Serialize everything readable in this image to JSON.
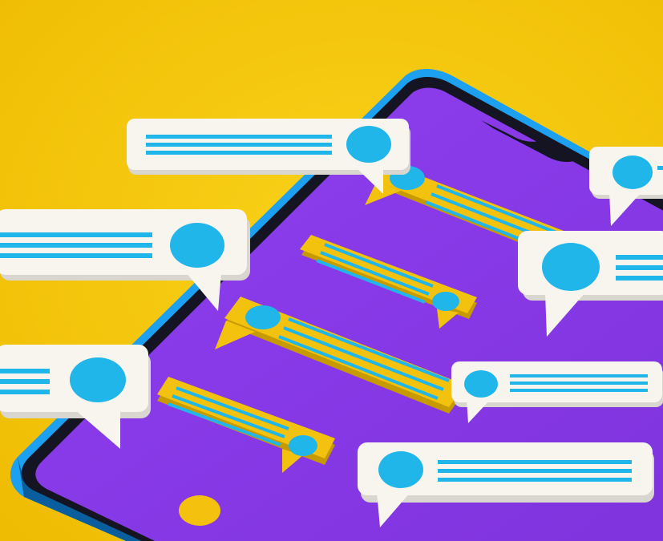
{
  "colors": {
    "background": "#F2C400",
    "background_light": "#FAD21A",
    "phone_frame": "#1EA0F0",
    "phone_frame_dark": "#0B5E9E",
    "phone_bezel": "#141423",
    "phone_screen": "#8A3CE8",
    "yellow_bubble": "#F2C20E",
    "yellow_bubble_shadow": "#C79A00",
    "white_bubble": "#F7F5EE",
    "white_bubble_side": "#D8D6CF",
    "accent_blue": "#20B6EA",
    "screen_button": "#F4C10F"
  },
  "scene": {
    "subject": "smartphone-with-chat-bubbles",
    "on_screen_yellow_bubbles": 4,
    "floating_white_bubbles": 7
  }
}
